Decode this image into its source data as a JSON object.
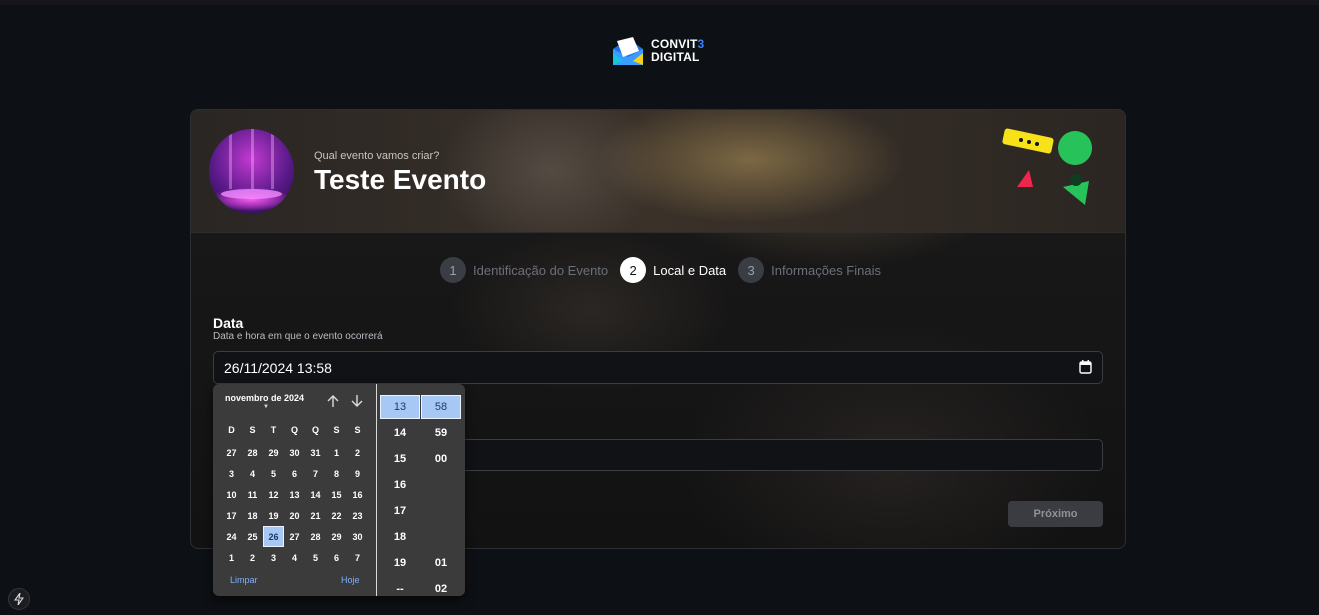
{
  "logo": {
    "line1_main": "CONVIT",
    "line1_accent": "3",
    "line2": "DIGITAL"
  },
  "header": {
    "subtitle": "Qual evento vamos criar?",
    "title": "Teste Evento"
  },
  "steps": [
    {
      "number": "1",
      "label": "Identificação do Evento",
      "state": "inactive"
    },
    {
      "number": "2",
      "label": "Local e Data",
      "state": "active"
    },
    {
      "number": "3",
      "label": "Informações Finais",
      "state": "inactive"
    }
  ],
  "form": {
    "date_label": "Data",
    "date_help": "Data e hora em que o evento ocorrerá",
    "date_value": "26/11/2024 13:58",
    "next_button": "Próximo"
  },
  "picker": {
    "month_label": "novembro de 2024",
    "weekdays": [
      "D",
      "S",
      "T",
      "Q",
      "Q",
      "S",
      "S"
    ],
    "days": [
      "27",
      "28",
      "29",
      "30",
      "31",
      "1",
      "2",
      "3",
      "4",
      "5",
      "6",
      "7",
      "8",
      "9",
      "10",
      "11",
      "12",
      "13",
      "14",
      "15",
      "16",
      "17",
      "18",
      "19",
      "20",
      "21",
      "22",
      "23",
      "24",
      "25",
      "26",
      "27",
      "28",
      "29",
      "30",
      "1",
      "2",
      "3",
      "4",
      "5",
      "6",
      "7"
    ],
    "selected_day": "26",
    "hours": [
      "13",
      "14",
      "15",
      "16",
      "17",
      "18",
      "19",
      "--"
    ],
    "minutes": [
      "58",
      "59",
      "00",
      "",
      "",
      "",
      "01",
      "02"
    ],
    "selected_hour": "13",
    "selected_minute": "58",
    "clear_label": "Limpar",
    "today_label": "Hoje"
  },
  "colors": {
    "accent": "#3b82f6",
    "selected_bg": "#a7c7f5",
    "picker_bg": "#3b3b3b"
  }
}
